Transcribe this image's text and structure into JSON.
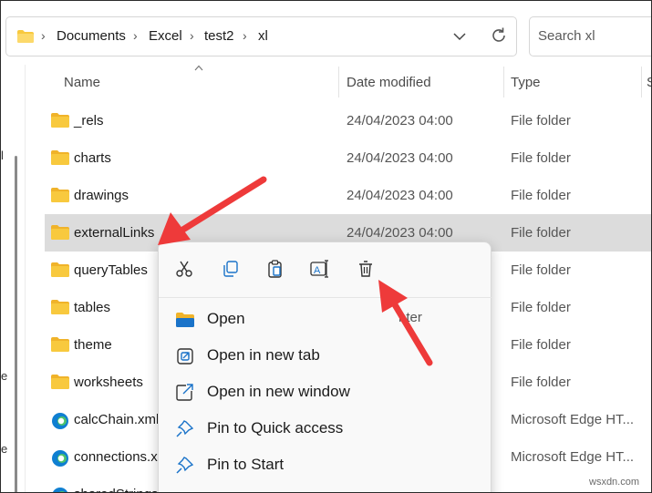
{
  "breadcrumb": [
    "Documents",
    "Excel",
    "test2",
    "xl"
  ],
  "search": {
    "placeholder": "Search xl"
  },
  "columns": {
    "name": "Name",
    "date": "Date modified",
    "type": "Type",
    "size": "S"
  },
  "rows": [
    {
      "name": "_rels",
      "date": "24/04/2023 04:00",
      "type": "File folder",
      "icon": "folder-icon"
    },
    {
      "name": "charts",
      "date": "24/04/2023 04:00",
      "type": "File folder",
      "icon": "folder-icon"
    },
    {
      "name": "drawings",
      "date": "24/04/2023 04:00",
      "type": "File folder",
      "icon": "folder-icon"
    },
    {
      "name": "externalLinks",
      "date": "24/04/2023 04:00",
      "type": "File folder",
      "icon": "folder-icon",
      "selected": true
    },
    {
      "name": "queryTables",
      "date": "",
      "type": "File folder",
      "icon": "folder-icon"
    },
    {
      "name": "tables",
      "date": "",
      "type": "File folder",
      "icon": "folder-icon"
    },
    {
      "name": "theme",
      "date": "",
      "type": "File folder",
      "icon": "folder-icon"
    },
    {
      "name": "worksheets",
      "date": "",
      "type": "File folder",
      "icon": "folder-icon"
    },
    {
      "name": "calcChain.xml",
      "date": "",
      "type": "Microsoft Edge HT...",
      "icon": "edge-icon"
    },
    {
      "name": "connections.xı",
      "date": "",
      "type": "Microsoft Edge HT...",
      "icon": "edge-icon"
    },
    {
      "name": "sharedStrings",
      "date": "",
      "type": "",
      "icon": "edge-icon"
    }
  ],
  "context_menu": {
    "toolbar": [
      "cut-icon",
      "copy-icon",
      "paste-icon",
      "rename-icon",
      "delete-icon"
    ],
    "items": [
      {
        "label": "Open",
        "icon": "folder-open-icon"
      },
      {
        "label": "Open in new tab",
        "icon": "new-tab-icon"
      },
      {
        "label": "Open in new window",
        "icon": "new-window-icon"
      },
      {
        "label": "Pin to Quick access",
        "icon": "pin-icon"
      },
      {
        "label": "Pin to Start",
        "icon": "pin-icon"
      }
    ],
    "obscured_text": "nter"
  },
  "nav_pane": {
    "letters": [
      "l",
      "e",
      "e"
    ]
  },
  "watermark": "wsxdn.com",
  "colors": {
    "folder": "#f8c93e",
    "arrow": "#ee3a3a",
    "selected_row": "#dcdcdc",
    "edge": "#0f7fd1"
  }
}
